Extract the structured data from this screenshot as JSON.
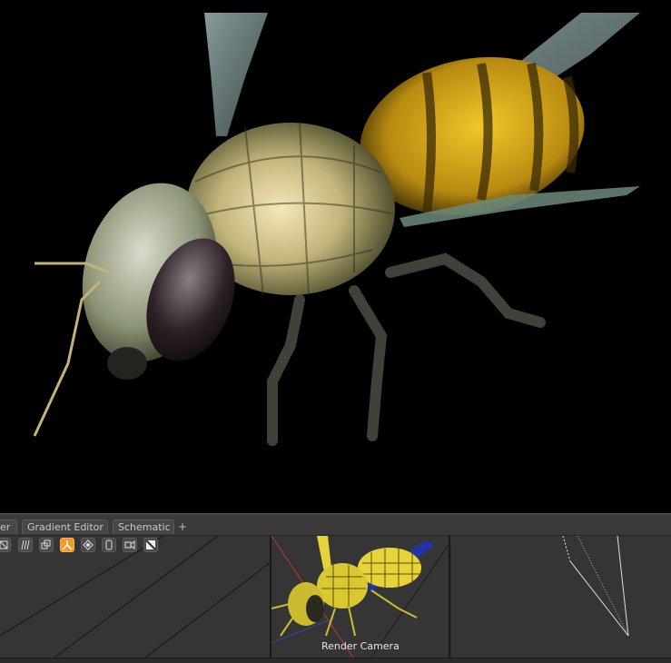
{
  "tabs": [
    {
      "label": "er"
    },
    {
      "label": "Gradient Editor"
    },
    {
      "label": "Schematic"
    }
  ],
  "tab_add_label": "+",
  "toolbar_icons": [
    "wireframe-box-icon",
    "hair-icon",
    "instance-icon",
    "joint-icon",
    "bounding-icon",
    "light-icon",
    "camera-icon",
    "texture-icon"
  ],
  "viewport": {
    "camera_label": "Render Camera"
  },
  "colors": {
    "accent": "#f29a2e",
    "tab_bg": "#474747",
    "panel_bg": "#353535"
  }
}
